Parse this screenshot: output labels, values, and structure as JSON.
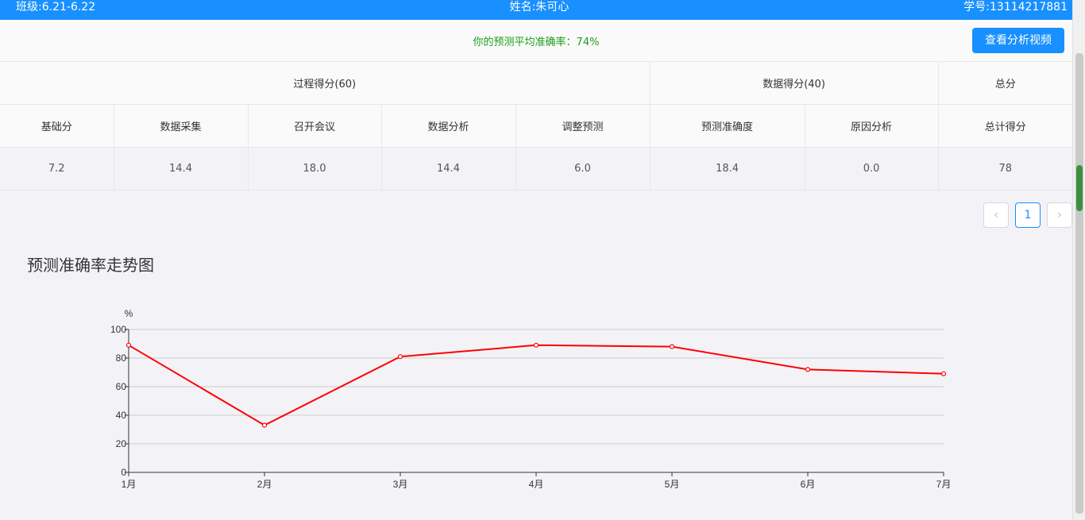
{
  "header": {
    "class_label": "班级:6.21-6.22",
    "student_name": "姓名:朱可心",
    "student_id": "学号:13114217881"
  },
  "summary": {
    "accuracy_text": "你的预测平均准确率：74%",
    "video_button": "查看分析视频"
  },
  "table": {
    "groups": {
      "process": "过程得分(60)",
      "data": "数据得分(40)",
      "total": "总分"
    },
    "columns": [
      "基础分",
      "数据采集",
      "召开会议",
      "数据分析",
      "调整预测",
      "预测准确度",
      "原因分析",
      "总计得分"
    ],
    "row": [
      "7.2",
      "14.4",
      "18.0",
      "14.4",
      "6.0",
      "18.4",
      "0.0",
      "78"
    ]
  },
  "pagination": {
    "prev": "‹",
    "current": "1",
    "next": "›"
  },
  "chart_section": {
    "title": "预测准确率走势图"
  },
  "chart_data": {
    "type": "line",
    "title": "预测准确率走势图",
    "ylabel": "%",
    "xlabel": "",
    "categories": [
      "1月",
      "2月",
      "3月",
      "4月",
      "5月",
      "6月",
      "7月"
    ],
    "values": [
      89,
      33,
      81,
      89,
      88,
      72,
      69
    ],
    "ylim": [
      0,
      100
    ],
    "yticks": [
      "0",
      "20",
      "40",
      "60",
      "80",
      "100"
    ],
    "grid": true,
    "color": "#ff0000"
  }
}
